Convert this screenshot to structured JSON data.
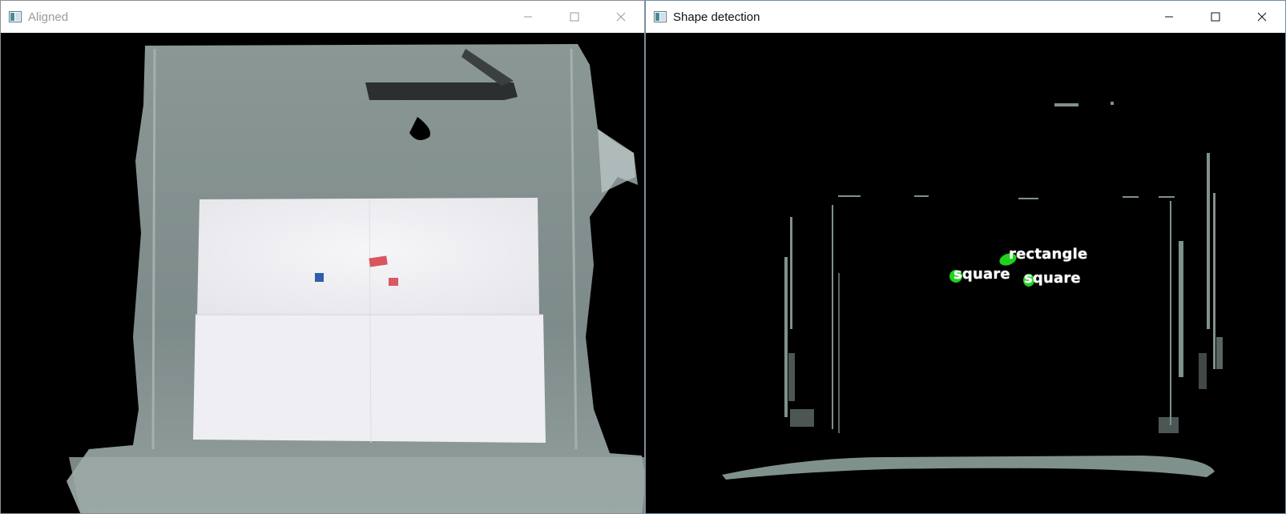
{
  "windows": {
    "aligned": {
      "title": "Aligned",
      "icon": "opencv-window-icon",
      "controls": [
        "minimize",
        "maximize",
        "close"
      ]
    },
    "shape_detection": {
      "title": "Shape detection",
      "icon": "opencv-window-icon",
      "controls": [
        "minimize",
        "maximize",
        "close"
      ],
      "detections": [
        {
          "label": "rectangle",
          "marker_color": "#1ed21e"
        },
        {
          "label": "square",
          "marker_color": "#1ed21e"
        },
        {
          "label": "square",
          "marker_color": "#1ed21e"
        }
      ]
    }
  },
  "colors": {
    "tray": "#8c9a96",
    "paper": "#f2f1f4",
    "red_block": "#d9565e",
    "blue_block": "#2f5fa8",
    "detection_green": "#1ed21e"
  }
}
